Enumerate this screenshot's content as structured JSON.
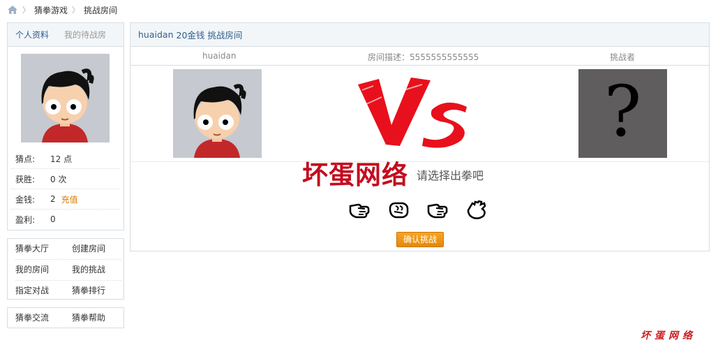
{
  "breadcrumb": {
    "items": [
      "猜拳游戏",
      "挑战房间"
    ]
  },
  "profile": {
    "tab_active": "个人资料",
    "tab_other": "我的待战房",
    "stats": [
      {
        "label": "猜点:",
        "value": "12 点"
      },
      {
        "label": "获胜:",
        "value": "0 次"
      },
      {
        "label": "金钱:",
        "value": "2",
        "action": "充值"
      },
      {
        "label": "盈利:",
        "value": "0"
      }
    ]
  },
  "nav1": [
    "猜拳大厅",
    "创建房间",
    "我的房间",
    "我的挑战",
    "指定对战",
    "猜拳排行"
  ],
  "nav2": [
    "猜拳交流",
    "猜拳帮助"
  ],
  "room": {
    "owner": "huaidan",
    "stake": "20金钱",
    "title_suffix": "挑战房间",
    "description": "房间描述：5555555555555",
    "challenger": "挑战者",
    "hint": "请选择出拳吧",
    "confirm": "确认挑战",
    "question_mark": "?"
  },
  "watermark": {
    "big": "坏蛋网络",
    "small": "坏蛋网络"
  },
  "colors": {
    "link": "#2f5f8c",
    "recharge": "#d77a00",
    "button": "#f39a12",
    "watermark": "#c40c1e"
  }
}
